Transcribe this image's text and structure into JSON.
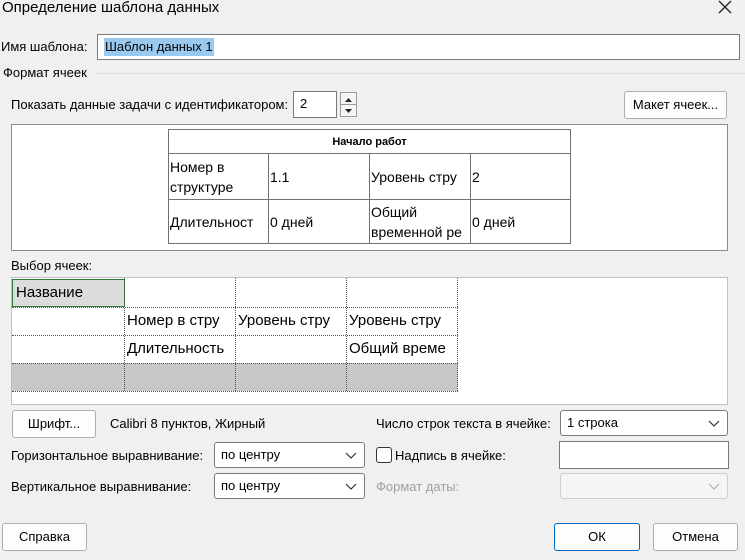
{
  "window": {
    "title": "Определение шаблона данных"
  },
  "template_name": {
    "label": "Имя шаблона:",
    "value": "Шаблон данных 1"
  },
  "cell_format": {
    "group_label": "Формат ячеек"
  },
  "task_id": {
    "label": "Показать данные задачи с идентификатором:",
    "value": "2"
  },
  "buttons": {
    "cell_layout": "Макет ячеек...",
    "font": "Шрифт...",
    "help": "Справка",
    "ok": "ОК",
    "cancel": "Отмена"
  },
  "preview": {
    "header": "Начало работ",
    "rows": [
      [
        "Номер в структуре",
        "1.1",
        "Уровень стру",
        "2"
      ],
      [
        "Длительност",
        "0 дней",
        "Общий временной ре",
        "0 дней"
      ]
    ]
  },
  "cell_selection": {
    "label": "Выбор ячеек:",
    "rows": [
      [
        "Название",
        "",
        "",
        ""
      ],
      [
        "",
        "Номер в стру",
        "Уровень стру",
        "Уровень стру"
      ],
      [
        "",
        "Длительность",
        "",
        "Общий време"
      ],
      [
        "",
        "",
        "",
        ""
      ]
    ]
  },
  "font_info": "Calibri 8 пунктов, Жирный",
  "lines_per_cell": {
    "label": "Число строк текста в ячейке:",
    "value": "1 строка"
  },
  "horizontal_align": {
    "label": "Горизонтальное выравнивание:",
    "value": "по центру"
  },
  "vertical_align": {
    "label": "Вертикальное выравнивание:",
    "value": "по центру"
  },
  "caption": {
    "label": "Надпись в ячейке:",
    "value": ""
  },
  "date_format": {
    "label": "Формат даты:",
    "value": ""
  },
  "icons": {
    "close": "close-icon",
    "spin_up": "spin-up-icon",
    "spin_down": "spin-down-icon",
    "dropdown": "chevron-down-icon"
  },
  "colors": {
    "primary_border": "#0067c0",
    "selected_cell": "#dcdcdc",
    "selected_cell_border": "#2e7d32",
    "shaded_row": "#c8c8c8",
    "text_selection": "#99c9ef"
  }
}
